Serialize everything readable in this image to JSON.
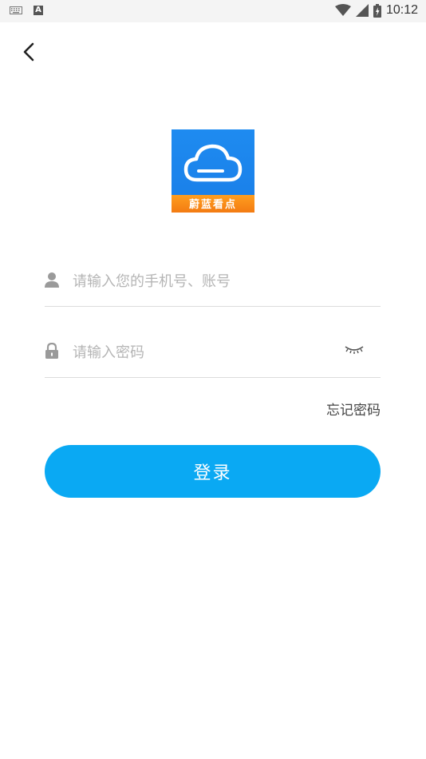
{
  "status_bar": {
    "time": "10:12",
    "left_icons": [
      "keyboard-icon",
      "a-notification-icon"
    ],
    "right_icons": [
      "wifi-icon",
      "cell-signal-icon",
      "battery-icon"
    ]
  },
  "header": {
    "back_icon": "chevron-left-icon"
  },
  "logo": {
    "text": "蔚蓝看点",
    "colors": {
      "blue": "#1e8bf0",
      "orange": "#f37b12"
    }
  },
  "form": {
    "username": {
      "value": "",
      "placeholder": "请输入您的手机号、账号",
      "icon": "user-icon"
    },
    "password": {
      "value": "",
      "placeholder": "请输入密码",
      "icon": "lock-icon",
      "toggle_icon": "eye-closed-icon"
    },
    "forgot_label": "忘记密码",
    "login_label": "登录"
  },
  "colors": {
    "accent": "#0aa9f3",
    "divider": "#dcdcdc",
    "placeholder": "#b5b5b5"
  }
}
